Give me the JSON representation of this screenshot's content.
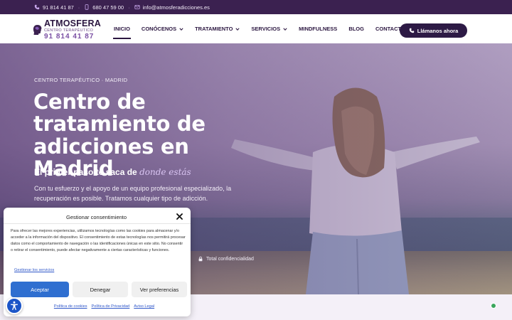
{
  "topbar": {
    "phone1": "91 814 41 87",
    "phone2": "680 47 59 00",
    "email": "info@atmosferadicciones.es",
    "separator": "·"
  },
  "logo": {
    "name": "ATMOSFERA",
    "subtitle": "CENTRO TERAPÉUTICO",
    "phone": "91 814 41 87"
  },
  "menu": {
    "items": [
      {
        "label": "INICIO",
        "has_dropdown": false,
        "active": true
      },
      {
        "label": "CONÓCENOS",
        "has_dropdown": true,
        "active": false
      },
      {
        "label": "TRATAMIENTO",
        "has_dropdown": true,
        "active": false
      },
      {
        "label": "SERVICIOS",
        "has_dropdown": true,
        "active": false
      },
      {
        "label": "MINDFULNESS",
        "has_dropdown": false,
        "active": false
      },
      {
        "label": "BLOG",
        "has_dropdown": false,
        "active": false
      },
      {
        "label": "CONTACTO",
        "has_dropdown": false,
        "active": false
      }
    ],
    "cta_label": "Llámanos ahora"
  },
  "hero": {
    "eyebrow": "CENTRO TERAPÉUTICO · MADRID",
    "headline": "Centro de tratamiento de adicciones en Madrid",
    "tagline_plain": "El primer paso te saca de ",
    "tagline_emph": "donde estás",
    "description": "Con tu esfuerzo y el apoyo de un equipo profesional especializado, la recuperación es posible. Tratamos cualquier tipo de adicción.",
    "confidential": "Total confidencialidad"
  },
  "cookie": {
    "title": "Gestionar consentimiento",
    "body": "Para ofrecer las mejores experiencias, utilizamos tecnologías como las cookies para almacenar y/o acceder a la información del dispositivo. El consentimiento de estas tecnologías nos permitirá procesar datos como el comportamiento de navegación o las identificaciones únicas en este sitio. No consentir o retirar el consentimiento, puede afectar negativamente a ciertas características y funciones.",
    "manage_link": "Gestionar los servicios",
    "accept": "Aceptar",
    "deny": "Denegar",
    "preferences": "Ver preferencias",
    "links": [
      "Política de cookies",
      "Política de Privacidad",
      "Aviso Legal"
    ]
  },
  "colors": {
    "brand_dark": "#2d1a45",
    "topbar": "#3b2150",
    "accept_blue": "#2f6fd0",
    "link_blue": "#2f57c9",
    "accent_lilac": "#d9c4f2"
  }
}
